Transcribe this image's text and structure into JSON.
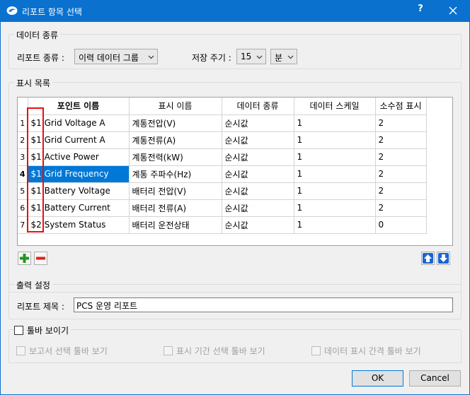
{
  "window": {
    "title": "리포트 항목 선택",
    "help": "?"
  },
  "data_type_group": {
    "title": "데이터 종류",
    "report_type_label": "리포트 종류 :",
    "report_type_value": "이력 데이터 그룹",
    "storage_period_label": "저장 주기 :",
    "storage_period_value": "15",
    "storage_unit_value": "분"
  },
  "display_list": {
    "title": "표시 목록",
    "columns": [
      "포인트 이름",
      "표시 이름",
      "데이터 종류",
      "데이터 스케일",
      "소수점 표시"
    ],
    "rows": [
      {
        "num": "1",
        "point": "$1.Grid Voltage A",
        "display": "계통전압(V)",
        "type": "순시값",
        "scale": "1",
        "decimals": "2"
      },
      {
        "num": "2",
        "point": "$1.Grid Current A",
        "display": "계통전류(A)",
        "type": "순시값",
        "scale": "1",
        "decimals": "2"
      },
      {
        "num": "3",
        "point": "$1.Active Power",
        "display": "계통전력(kW)",
        "type": "순시값",
        "scale": "1",
        "decimals": "2"
      },
      {
        "num": "4",
        "point": "$1.Grid Frequency",
        "display": "계통 주파수(Hz)",
        "type": "순시값",
        "scale": "1",
        "decimals": "2"
      },
      {
        "num": "5",
        "point": "$1.Battery Voltage",
        "display": "배터리 전압(V)",
        "type": "순시값",
        "scale": "1",
        "decimals": "2"
      },
      {
        "num": "6",
        "point": "$1.Battery Current",
        "display": "배터리 전류(A)",
        "type": "순시값",
        "scale": "1",
        "decimals": "2"
      },
      {
        "num": "7",
        "point": "$2.System Status",
        "display": "배터리 운전상태",
        "type": "순시값",
        "scale": "1",
        "decimals": "0"
      }
    ],
    "selected_row": 4
  },
  "output_group": {
    "title": "출력 설정",
    "report_title_label": "리포트 제목 :",
    "report_title_value": "PCS 운영 리포트"
  },
  "toolbar_group": {
    "title": "툴바 보이기",
    "opt1": "보고서 선택 툴바 보기",
    "opt2": "표시 기간 선택 툴바 보기",
    "opt3": "데이터 표시 간격 툴바 보기"
  },
  "buttons": {
    "ok": "OK",
    "cancel": "Cancel"
  },
  "colors": {
    "titlebar": "#0a71cf",
    "selection": "#0078d7",
    "highlight_box": "#e81010",
    "add_icon": "#1f9a1f",
    "remove_icon": "#d9251d",
    "move_icon": "#1a64d6"
  }
}
